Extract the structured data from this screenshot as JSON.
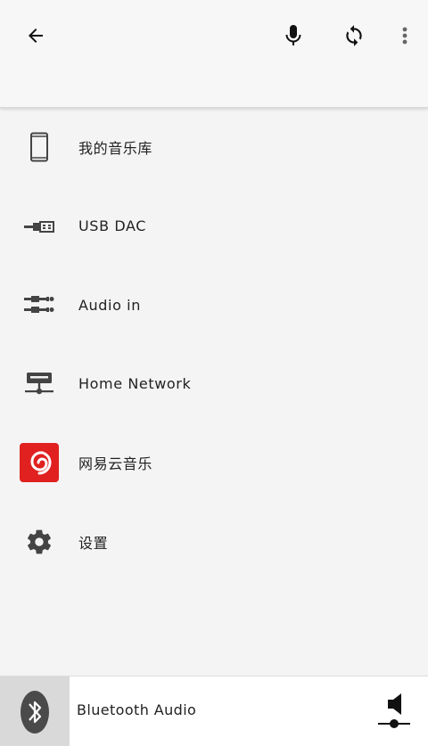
{
  "topbar": {
    "back_icon": "arrow-left-icon",
    "mic_icon": "microphone-icon",
    "refresh_icon": "refresh-icon",
    "more_icon": "more-vertical-icon"
  },
  "sources": [
    {
      "label": "我的音乐库",
      "icon": "phone-icon"
    },
    {
      "label": "USB DAC",
      "icon": "usb-icon"
    },
    {
      "label": "Audio in",
      "icon": "audio-jack-icon"
    },
    {
      "label": "Home Network",
      "icon": "network-icon"
    },
    {
      "label": "网易云音乐",
      "icon": "netease-music-icon",
      "color": "#e0211f"
    },
    {
      "label": "设置",
      "icon": "gear-icon"
    }
  ],
  "footer": {
    "bluetooth_label": "Bluetooth Audio",
    "bluetooth_icon": "bluetooth-icon",
    "volume_icon": "speaker-volume-icon"
  }
}
